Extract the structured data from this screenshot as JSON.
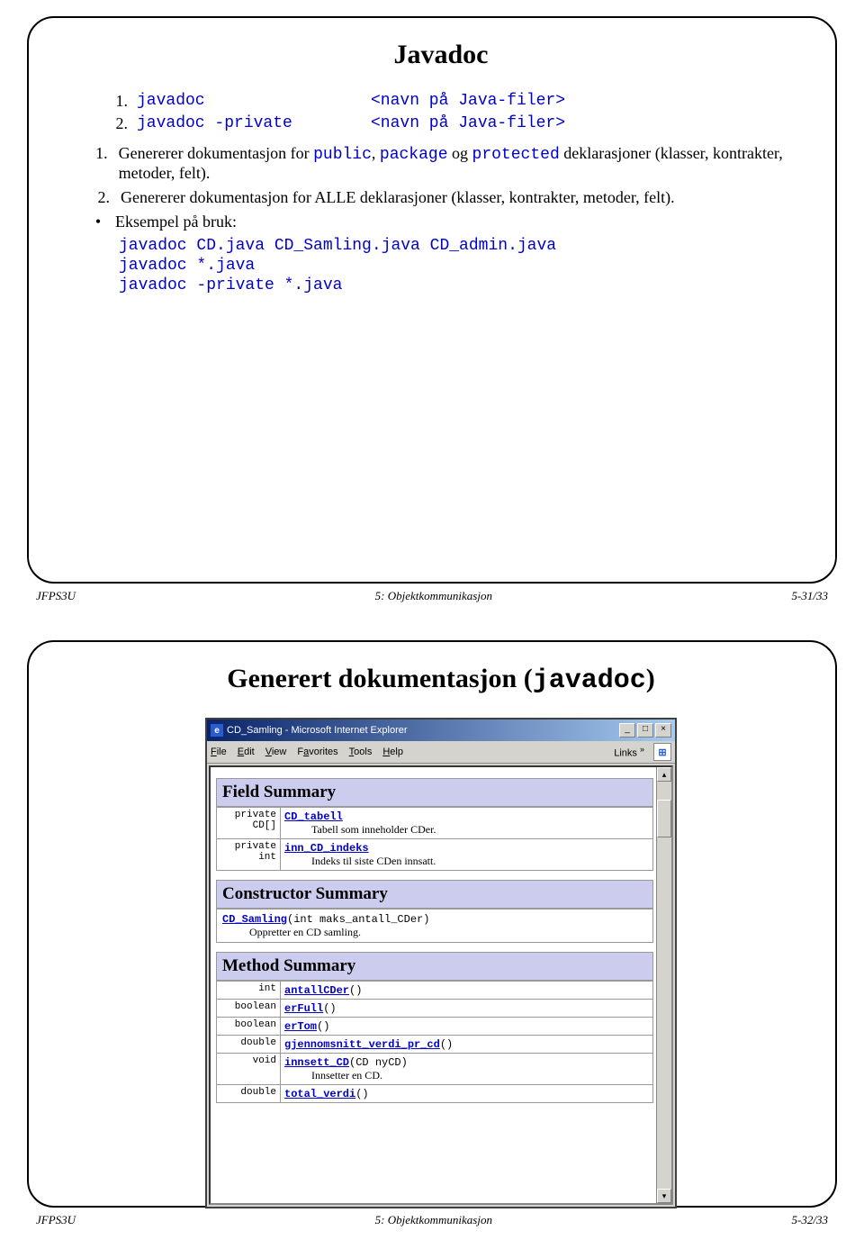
{
  "slide1": {
    "title": "Javadoc",
    "items": [
      {
        "num": "1.",
        "cmd": "javadoc",
        "arg": "<navn på Java-filer>"
      },
      {
        "num": "2.",
        "cmd": "javadoc -private",
        "arg": "<navn på Java-filer>"
      }
    ],
    "bullets": [
      {
        "pre": "Genererer dokumentasjon for ",
        "code": [
          "public",
          "package",
          "protected"
        ],
        "post": " deklarasjoner (klasser, kontrakter, metoder, felt).",
        "num": "1."
      },
      {
        "pre": "Genererer dokumentasjon for ALLE deklarasjoner (klasser, kontrakter, metoder, felt).",
        "num": "2."
      },
      {
        "bullet": "•",
        "text": "Eksempel på bruk:"
      }
    ],
    "code": [
      "javadoc CD.java CD_Samling.java CD_admin.java",
      "javadoc *.java",
      "javadoc -private *.java"
    ],
    "footer": {
      "left": "JFPS3U",
      "center": "5: Objektkommunikasjon",
      "right": "5-31/33"
    }
  },
  "slide2": {
    "title_pre": "Generert dokumentasjon (",
    "title_code": "javadoc",
    "title_post": ")",
    "window": {
      "title": "CD_Samling - Microsoft Internet Explorer",
      "menus": [
        "File",
        "Edit",
        "View",
        "Favorites",
        "Tools",
        "Help"
      ],
      "links_label": "Links",
      "sections": {
        "field": {
          "heading": "Field Summary",
          "rows": [
            {
              "type": "private CD[]",
              "link": "CD_tabell",
              "desc": "Tabell som inneholder CDer."
            },
            {
              "type": "private int",
              "link": "inn_CD_indeks",
              "desc": "Indeks til siste CDen innsatt."
            }
          ]
        },
        "ctor": {
          "heading": "Constructor Summary",
          "rows": [
            {
              "sig_link": "CD_Samling",
              "sig_args": "(int maks_antall_CDer)",
              "desc": "Oppretter en CD samling."
            }
          ]
        },
        "method": {
          "heading": "Method Summary",
          "rows": [
            {
              "type": "int",
              "link": "antallCDer",
              "args": "()"
            },
            {
              "type": "boolean",
              "link": "erFull",
              "args": "()"
            },
            {
              "type": "boolean",
              "link": "erTom",
              "args": "()"
            },
            {
              "type": "double",
              "link": "gjennomsnitt_verdi_pr_cd",
              "args": "()"
            },
            {
              "type": "void",
              "link": "innsett_CD",
              "args": "(CD nyCD)",
              "desc": "Innsetter en CD."
            },
            {
              "type": "double",
              "link": "total_verdi",
              "args": "()"
            }
          ]
        }
      }
    },
    "footer": {
      "left": "JFPS3U",
      "center": "5: Objektkommunikasjon",
      "right": "5-32/33"
    }
  }
}
